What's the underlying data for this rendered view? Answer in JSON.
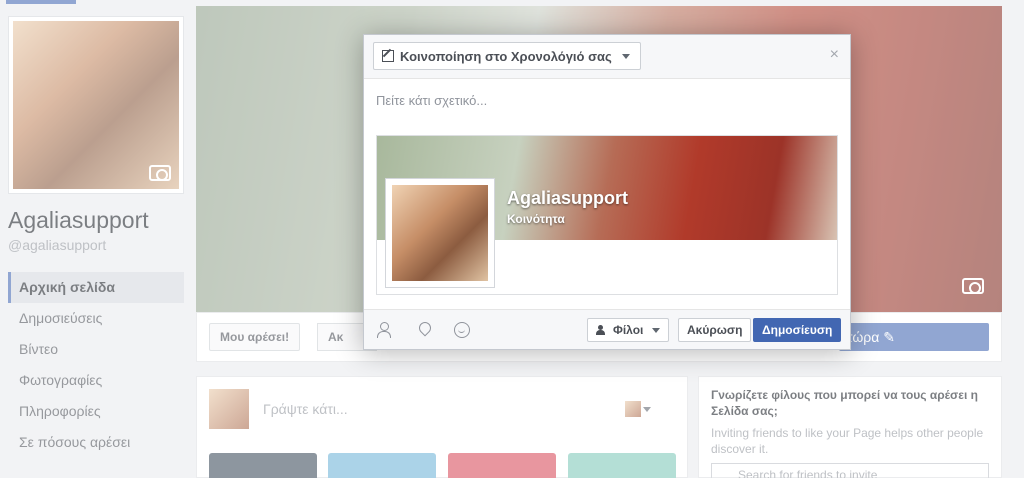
{
  "page": {
    "name": "Agaliasupport",
    "handle": "@agaliasupport",
    "nav": [
      "Αρχική σελίδα",
      "Δημοσιεύσεις",
      "Βίντεο",
      "Φωτογραφίες",
      "Πληροφορίες",
      "Σε πόσους αρέσει"
    ]
  },
  "actions": {
    "like": "Μου αρέσει!",
    "follow": "Ακ",
    "cta": "τώρα ✎"
  },
  "composer": {
    "placeholder": "Γράψτε κάτι..."
  },
  "invite": {
    "title": "Γνωρίζετε φίλους που μπορεί να τους αρέσει η Σελίδα σας;",
    "subtitle": "Inviting friends to like your Page helps other people discover it.",
    "search_placeholder": "Search for friends to invite"
  },
  "dialog": {
    "share_target": "Κοινοποίηση στο Χρονολόγιό σας",
    "close": "×",
    "say_something_placeholder": "Πείτε κάτι σχετικό...",
    "preview": {
      "name": "Agaliasupport",
      "category": "Κοινότητα"
    },
    "audience": "Φίλοι",
    "cancel": "Ακύρωση",
    "publish": "Δημοσίευση"
  }
}
